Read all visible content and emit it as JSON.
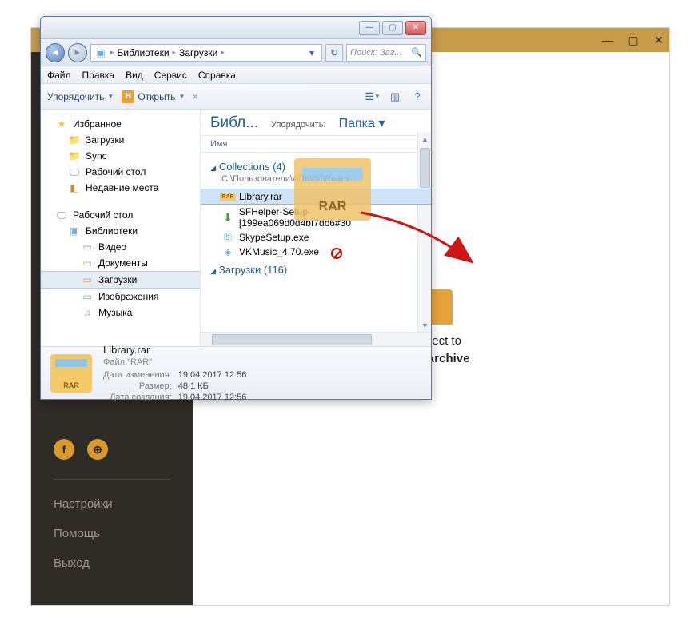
{
  "bgApp": {
    "dropText1": "or Select to",
    "dropText2": "Open Archive",
    "side": {
      "settings": "Настройки",
      "help": "Помощь",
      "exit": "Выход"
    }
  },
  "explorer": {
    "breadcrumb": {
      "seg1": "Библиотеки",
      "seg2": "Загрузки"
    },
    "searchPlaceholder": "Поиск: Заг...",
    "menu": {
      "file": "Файл",
      "edit": "Правка",
      "view": "Вид",
      "service": "Сервис",
      "help": "Справка"
    },
    "toolbar": {
      "organize": "Упорядочить",
      "open": "Открыть"
    },
    "tree": {
      "favorites": "Избранное",
      "downloads": "Загрузки",
      "sync": "Sync",
      "desktop": "Рабочий стол",
      "recent": "Недавние места",
      "desktop2": "Рабочий стол",
      "libraries": "Библиотеки",
      "video": "Видео",
      "documents": "Документы",
      "downloads2": "Загрузки",
      "images": "Изображения",
      "music": "Музыка"
    },
    "list": {
      "headerTitle": "Библ...",
      "sortLabel": "Упорядочить:",
      "sortValue": "Папка",
      "colName": "Имя",
      "group1": {
        "title": "Collections (4)",
        "sub": "C:\\Пользователи\\АПКИИ\\Roami..."
      },
      "files": {
        "f1": "Library.rar",
        "f2": "SFHelper-Setup-[199ea069d0d4bf7db6#30",
        "f3": "SkypeSetup.exe",
        "f4": "VKMusic_4.70.exe"
      },
      "group2": {
        "title": "Загрузки (116)"
      }
    },
    "details": {
      "name": "Library.rar",
      "type": "Файл \"RAR\"",
      "modLabel": "Дата изменения:",
      "modVal": "19.04.2017 12:56",
      "sizeLabel": "Размер:",
      "sizeVal": "48,1 КБ",
      "createdLabel": "Дата создания:",
      "createdVal": "19.04.2017 12:56",
      "thumbLabel": "RAR"
    }
  },
  "dragGhost": {
    "label": "RAR"
  }
}
